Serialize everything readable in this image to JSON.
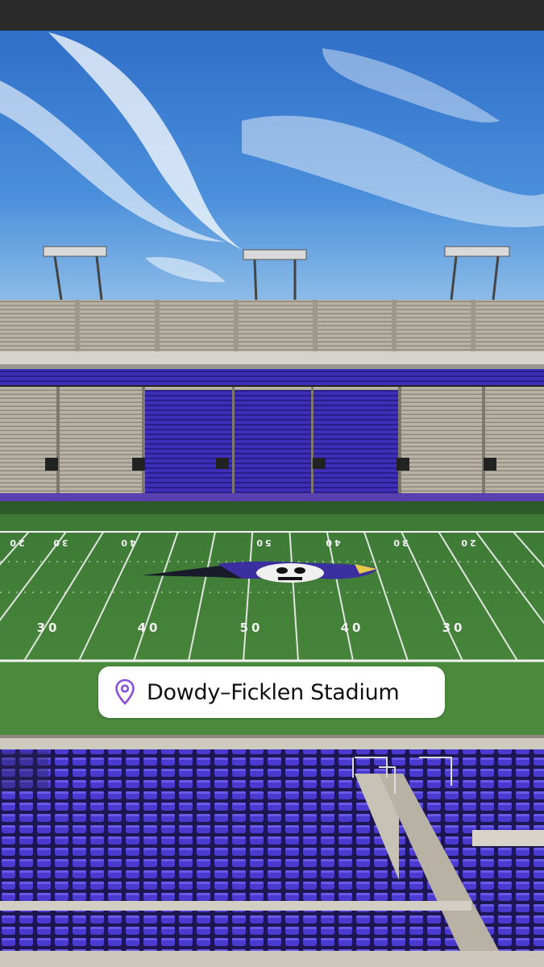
{
  "location_sticker": {
    "label": "Dowdy–Ficklen Stadium",
    "icon": "location-pin-icon",
    "icon_color": "#8a4fd8"
  },
  "field": {
    "yard_numbers_near": [
      "30",
      "40",
      "50",
      "40",
      "30"
    ],
    "yard_numbers_far": [
      "20",
      "30",
      "40",
      "50",
      "40",
      "30",
      "20"
    ],
    "turf_color": "#3f7a38",
    "seat_color": "#4536c9"
  },
  "sky_color": "#3f85d6"
}
